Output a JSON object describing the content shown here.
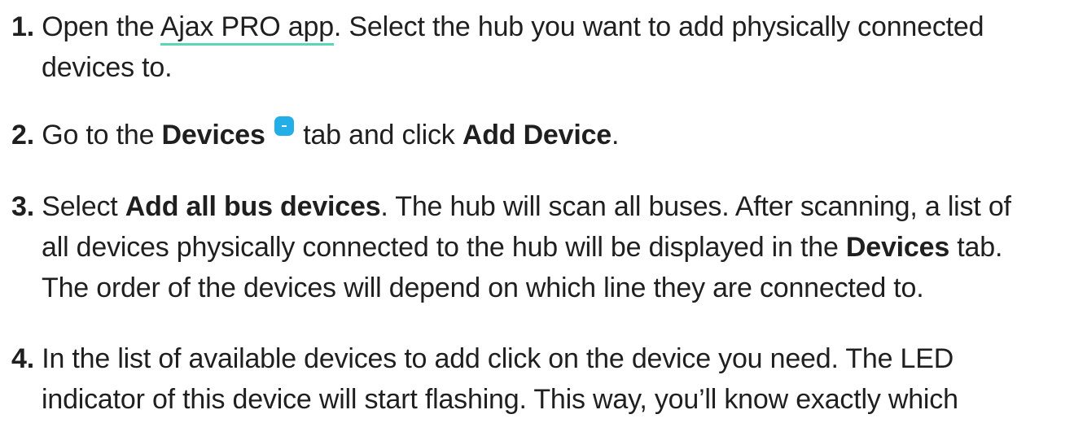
{
  "steps": [
    {
      "number": "1.",
      "parts": {
        "a": "Open the ",
        "link": "Ajax PRO app",
        "b": ". Select the hub you want to add physically connected",
        "line2": "devices to."
      }
    },
    {
      "number": "2.",
      "parts": {
        "a": "Go to the ",
        "bold1": "Devices",
        "b": " tab and click ",
        "bold2": "Add Device",
        "c": "."
      },
      "icon": "devices-tab-icon"
    },
    {
      "number": "3.",
      "parts": {
        "a": "Select ",
        "bold1": "Add all bus devices",
        "b": ". The hub will scan all buses. After scanning, a list of",
        "line2a": "all devices physically connected to the hub will be displayed in the ",
        "bold2": "Devices",
        "line2b": " tab.",
        "line3": "The order of the devices will depend on which line they are connected to."
      }
    },
    {
      "number": "4.",
      "parts": {
        "a": "In the list of available devices to add click on the device you need. The LED",
        "line2": "indicator of this device will start flashing. This way, you’ll know exactly which"
      }
    }
  ],
  "colors": {
    "text": "#1f1f1f",
    "link_underline": "#59d6b6",
    "icon": "#24aee8"
  }
}
